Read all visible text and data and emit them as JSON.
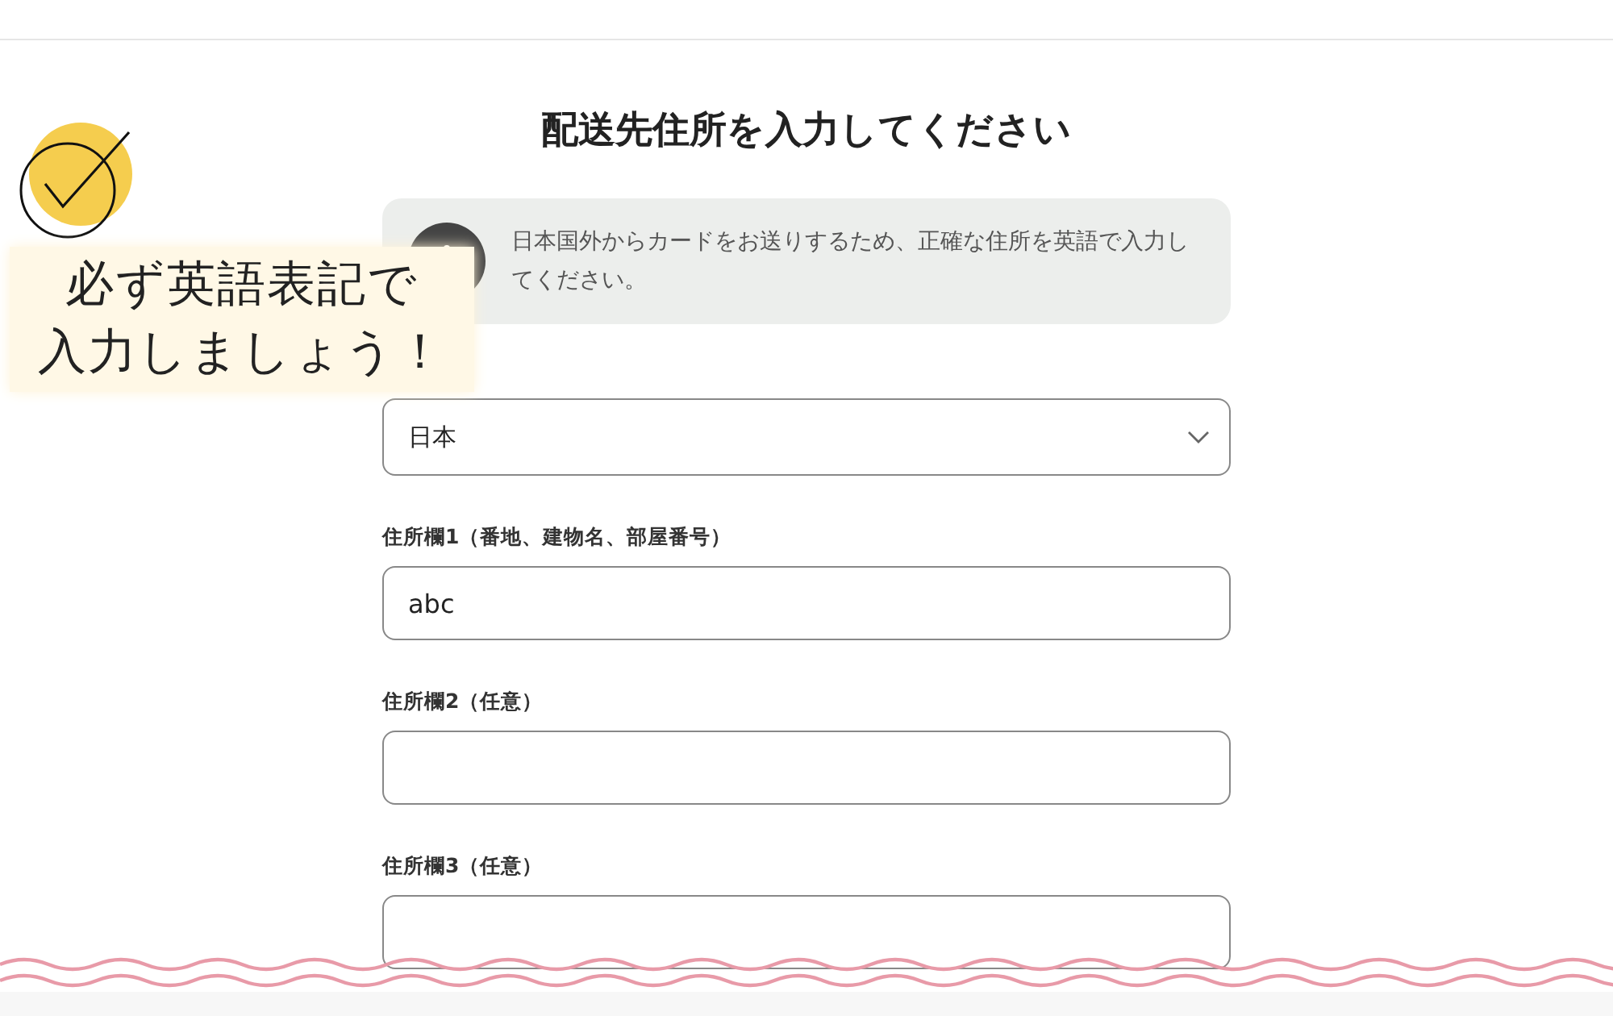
{
  "title": "配送先住所を入力してください",
  "notice": {
    "text": "日本国外からカードをお送りするため、正確な住所を英語で入力してください。"
  },
  "country_select": {
    "value": "日本"
  },
  "fields": [
    {
      "label": "住所欄1（番地、建物名、部屋番号）",
      "value": "abc"
    },
    {
      "label": "住所欄2（任意）"
    },
    {
      "label": "住所欄3（任意）"
    }
  ],
  "annotation": {
    "lines": [
      "必ず英語表記で",
      "入力しましょう！"
    ]
  }
}
